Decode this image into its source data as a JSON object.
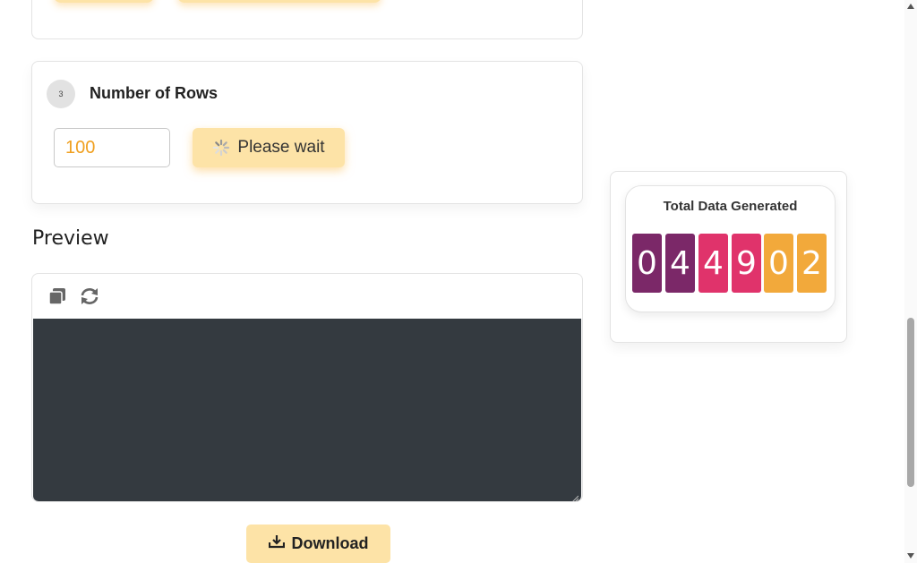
{
  "rows_section": {
    "step_number": "3",
    "title": "Number of Rows",
    "input_value": "100",
    "wait_label": "Please wait"
  },
  "preview": {
    "heading": "Preview",
    "copy_icon": "copy-icon",
    "refresh_icon": "refresh-icon",
    "code_content": ""
  },
  "download": {
    "label": "Download",
    "icon": "download-icon"
  },
  "stats": {
    "title": "Total Data Generated",
    "digits": [
      {
        "value": "0",
        "color": "#7b2868"
      },
      {
        "value": "4",
        "color": "#7b2868"
      },
      {
        "value": "4",
        "color": "#e0336b"
      },
      {
        "value": "9",
        "color": "#e0336b"
      },
      {
        "value": "0",
        "color": "#f2a93b"
      },
      {
        "value": "2",
        "color": "#f2a93b"
      }
    ]
  },
  "colors": {
    "accent": "#fde3a7",
    "input_text": "#f0a020",
    "code_bg": "#343a40"
  }
}
